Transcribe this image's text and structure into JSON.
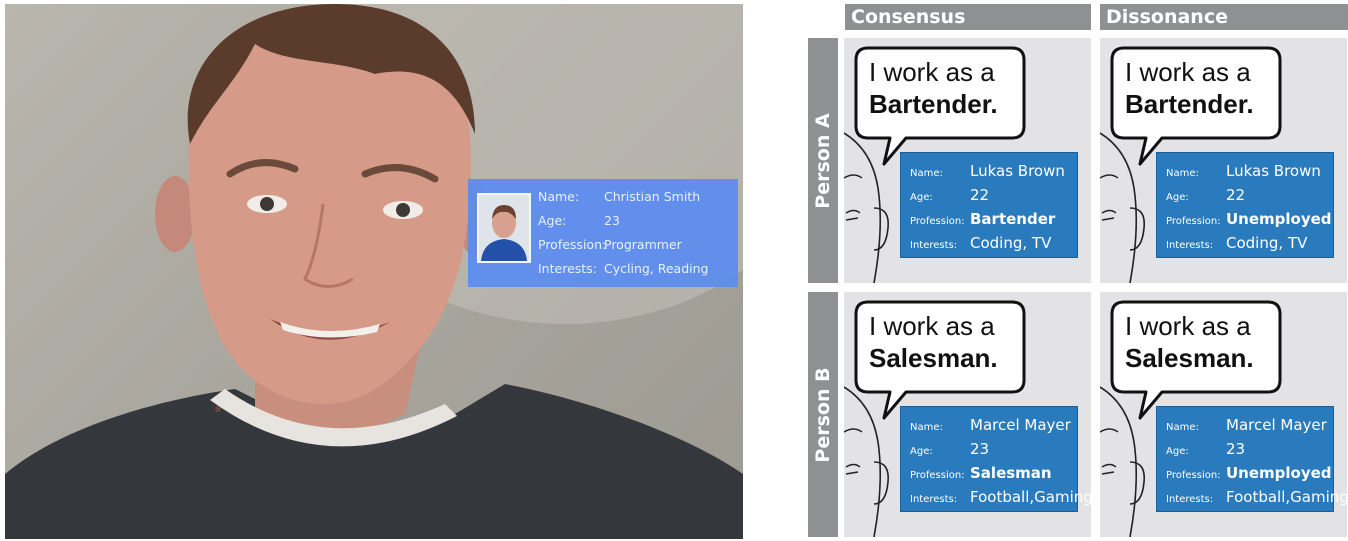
{
  "photo": {
    "ar_card": {
      "rows": [
        {
          "key": "Name:",
          "value": "Christian Smith"
        },
        {
          "key": "Age:",
          "value": "23"
        },
        {
          "key": "Profession:",
          "value": "Programmer"
        },
        {
          "key": "Interests:",
          "value": "Cycling, Reading"
        }
      ]
    }
  },
  "study": {
    "columns": [
      "Consensus",
      "Dissonance"
    ],
    "rows": [
      "Person A",
      "Person B"
    ],
    "cells": [
      {
        "bubble": {
          "line1": "I work as a",
          "line2": "Bartender."
        },
        "card": [
          {
            "key": "Name:",
            "value": "Lukas Brown"
          },
          {
            "key": "Age:",
            "value": "22"
          },
          {
            "key": "Profession:",
            "value": "Bartender"
          },
          {
            "key": "Interests:",
            "value": "Coding, TV"
          }
        ]
      },
      {
        "bubble": {
          "line1": "I work as a",
          "line2": "Bartender."
        },
        "card": [
          {
            "key": "Name:",
            "value": "Lukas Brown"
          },
          {
            "key": "Age:",
            "value": "22"
          },
          {
            "key": "Profession:",
            "value": "Unemployed"
          },
          {
            "key": "Interests:",
            "value": "Coding, TV"
          }
        ]
      },
      {
        "bubble": {
          "line1": "I work as a",
          "line2": "Salesman."
        },
        "card": [
          {
            "key": "Name:",
            "value": "Marcel Mayer"
          },
          {
            "key": "Age:",
            "value": "23"
          },
          {
            "key": "Profession:",
            "value": "Salesman"
          },
          {
            "key": "Interests:",
            "value": "Football,Gaming"
          }
        ]
      },
      {
        "bubble": {
          "line1": "I work as a",
          "line2": "Salesman."
        },
        "card": [
          {
            "key": "Name:",
            "value": "Marcel Mayer"
          },
          {
            "key": "Age:",
            "value": "23"
          },
          {
            "key": "Profession:",
            "value": "Unemployed"
          },
          {
            "key": "Interests:",
            "value": "Football,Gaming"
          }
        ]
      }
    ]
  }
}
